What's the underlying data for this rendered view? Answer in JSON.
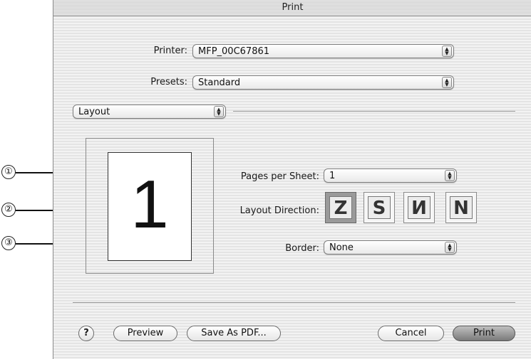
{
  "dialog": {
    "title": "Print"
  },
  "printer": {
    "label": "Printer:",
    "value": "MFP_00C67861"
  },
  "presets": {
    "label": "Presets:",
    "value": "Standard"
  },
  "panel_select": {
    "value": "Layout"
  },
  "preview": {
    "page_number": "1"
  },
  "pages_per_sheet": {
    "label": "Pages per Sheet:",
    "value": "1"
  },
  "layout_direction": {
    "label": "Layout Direction:",
    "options": [
      {
        "icon": "z-left-right-icon",
        "glyph": "Z",
        "selected": true
      },
      {
        "icon": "z-right-left-icon",
        "glyph": "S",
        "selected": false
      },
      {
        "icon": "n-top-bottom-icon",
        "glyph": "И",
        "selected": false
      },
      {
        "icon": "n-top-bottom-reverse-icon",
        "glyph": "N",
        "selected": false
      }
    ]
  },
  "border": {
    "label": "Border:",
    "value": "None"
  },
  "buttons": {
    "help": "?",
    "preview": "Preview",
    "save_pdf": "Save As PDF...",
    "cancel": "Cancel",
    "print": "Print"
  },
  "callouts": [
    "①",
    "②",
    "③"
  ]
}
